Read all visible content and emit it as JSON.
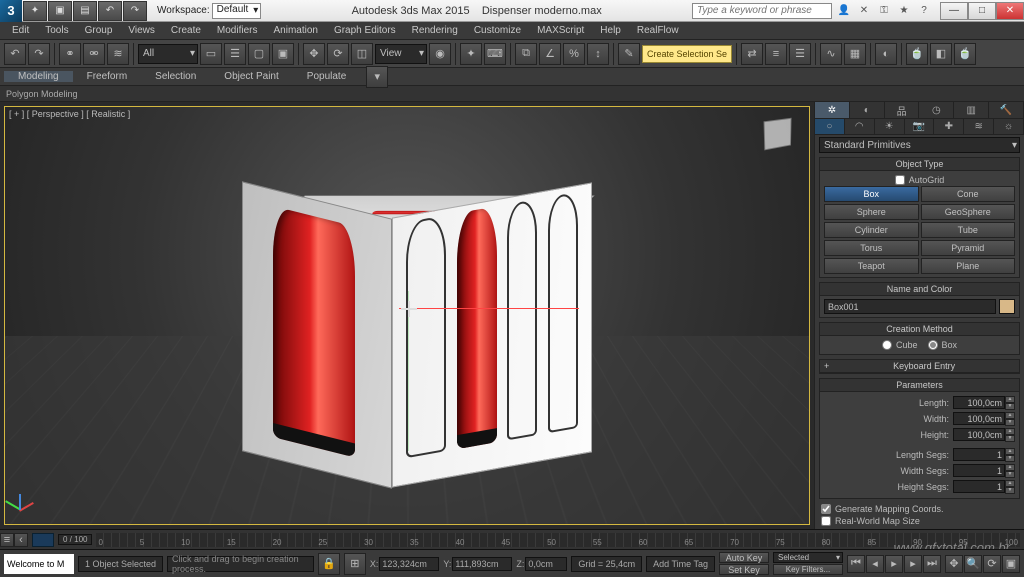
{
  "app": {
    "title": "Autodesk 3ds Max 2015",
    "filename": "Dispenser moderno.max",
    "workspace_label": "Workspace:",
    "workspace_value": "Default",
    "search_placeholder": "Type a keyword or phrase"
  },
  "window_controls": {
    "min": "—",
    "max": "□",
    "close": "✕"
  },
  "menu": [
    "Edit",
    "Tools",
    "Group",
    "Views",
    "Create",
    "Modifiers",
    "Animation",
    "Graph Editors",
    "Rendering",
    "Customize",
    "MAXScript",
    "Help",
    "RealFlow"
  ],
  "main_toolbar": {
    "selfilter": "All",
    "viewmode": "View",
    "create_sel_set": "Create Selection Se"
  },
  "ribbon": {
    "tabs": [
      "Modeling",
      "Freeform",
      "Selection",
      "Object Paint",
      "Populate"
    ],
    "active": 0,
    "sub": "Polygon Modeling"
  },
  "viewport": {
    "label": "[ + ] [ Perspective ] [ Realistic ]"
  },
  "cmd_panel": {
    "category": "Standard Primitives",
    "object_type_head": "Object Type",
    "autogrid": "AutoGrid",
    "buttons": [
      [
        "Box",
        "Cone"
      ],
      [
        "Sphere",
        "GeoSphere"
      ],
      [
        "Cylinder",
        "Tube"
      ],
      [
        "Torus",
        "Pyramid"
      ],
      [
        "Teapot",
        "Plane"
      ]
    ],
    "selected_btn": "Box",
    "name_color_head": "Name and Color",
    "object_name": "Box001",
    "creation_head": "Creation Method",
    "creation_opts": {
      "a": "Cube",
      "b": "Box",
      "sel": "b"
    },
    "keyboard_head": "Keyboard Entry",
    "params_head": "Parameters",
    "params": [
      {
        "label": "Length:",
        "value": "100,0cm"
      },
      {
        "label": "Width:",
        "value": "100,0cm"
      },
      {
        "label": "Height:",
        "value": "100,0cm"
      },
      {
        "label": "Length Segs:",
        "value": "1"
      },
      {
        "label": "Width Segs:",
        "value": "1"
      },
      {
        "label": "Height Segs:",
        "value": "1"
      }
    ],
    "gen_map": "Generate Mapping Coords.",
    "real_world": "Real-World Map Size"
  },
  "timeline": {
    "frame": "0 / 100",
    "ticks": [
      "0",
      "5",
      "10",
      "15",
      "20",
      "25",
      "30",
      "35",
      "40",
      "45",
      "50",
      "55",
      "60",
      "65",
      "70",
      "75",
      "80",
      "85",
      "90",
      "95",
      "100"
    ]
  },
  "status": {
    "welcome": "Welcome to M",
    "selection": "1 Object Selected",
    "hint": "Click and drag to begin creation process.",
    "x": "123,324cm",
    "y": "111,893cm",
    "z": "0,0cm",
    "grid": "Grid = 25,4cm",
    "autokey": "Auto Key",
    "setkey": "Set Key",
    "selected": "Selected",
    "keyfilters": "Key Filters...",
    "addtime": "Add Time Tag"
  },
  "watermark": "www.gfxtotal.com.br"
}
